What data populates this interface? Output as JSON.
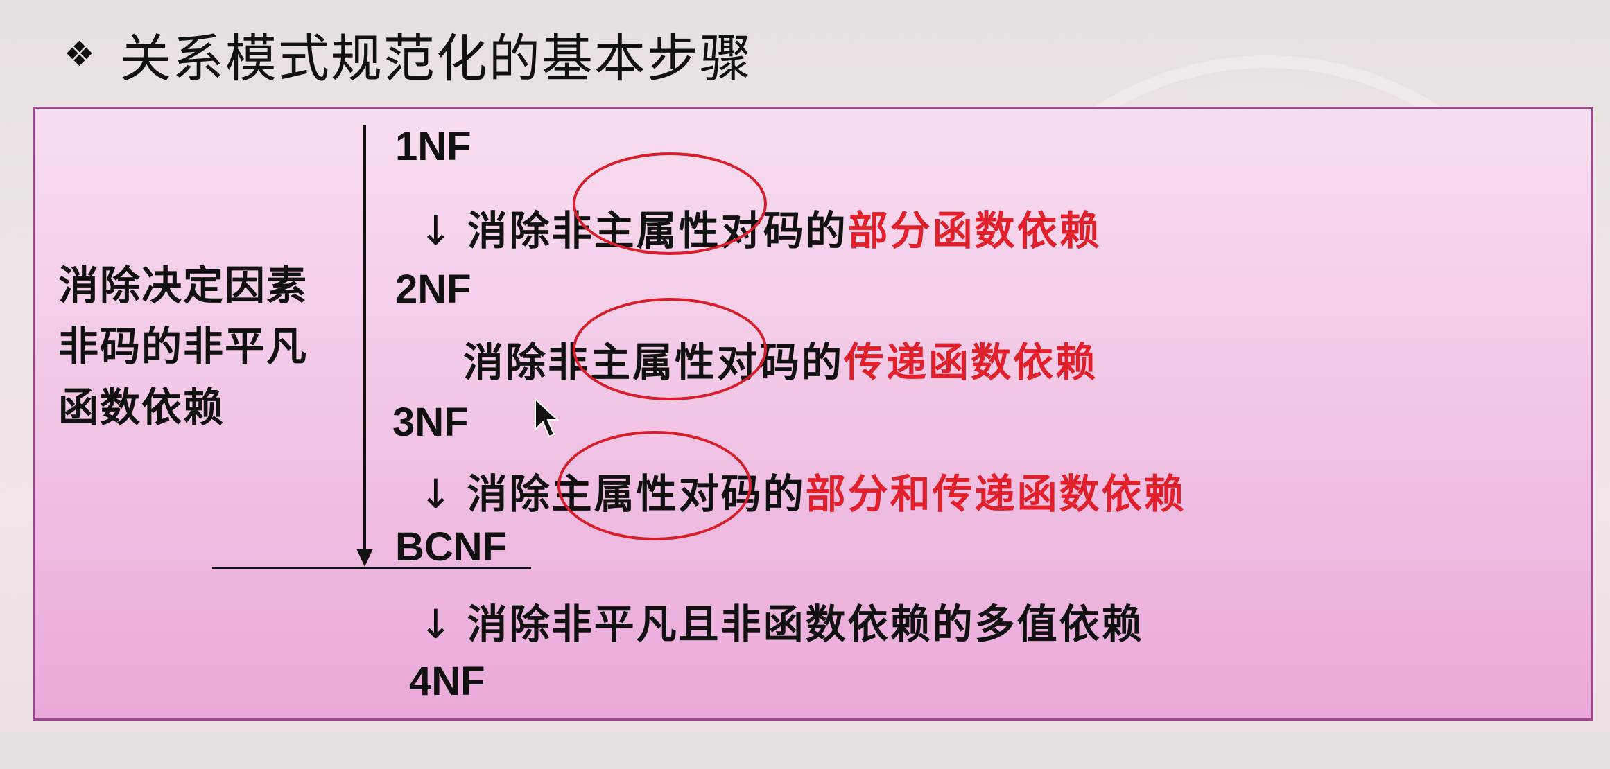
{
  "title": {
    "bullet": "❖",
    "text": "关系模式规范化的基本步骤"
  },
  "left_label": {
    "lines": [
      "消除决定因素",
      "非码的非平凡",
      "函数依赖"
    ]
  },
  "forms": {
    "nf1": "1NF",
    "nf2": "2NF",
    "nf3": "3NF",
    "bcnf": "BCNF",
    "nf4": "4NF"
  },
  "steps": [
    {
      "arrow": "↓",
      "text": "消除非主属性对码的",
      "highlight": "部分函数依赖"
    },
    {
      "arrow": "",
      "text": "消除非主属性对码的",
      "highlight": "传递函数依赖"
    },
    {
      "arrow": "↓",
      "text": "消除主属性对码的",
      "highlight": "部分和传递函数依赖"
    },
    {
      "arrow": "↓",
      "text": "消除非平凡且非函数依赖的多值依赖",
      "highlight": ""
    }
  ],
  "colors": {
    "highlight": "#e0202a",
    "box_border": "#9a4a8c",
    "circle": "#d61f2a"
  },
  "icons": {
    "bullet": "diamond-bullet-icon",
    "cursor": "mouse-pointer-icon"
  }
}
